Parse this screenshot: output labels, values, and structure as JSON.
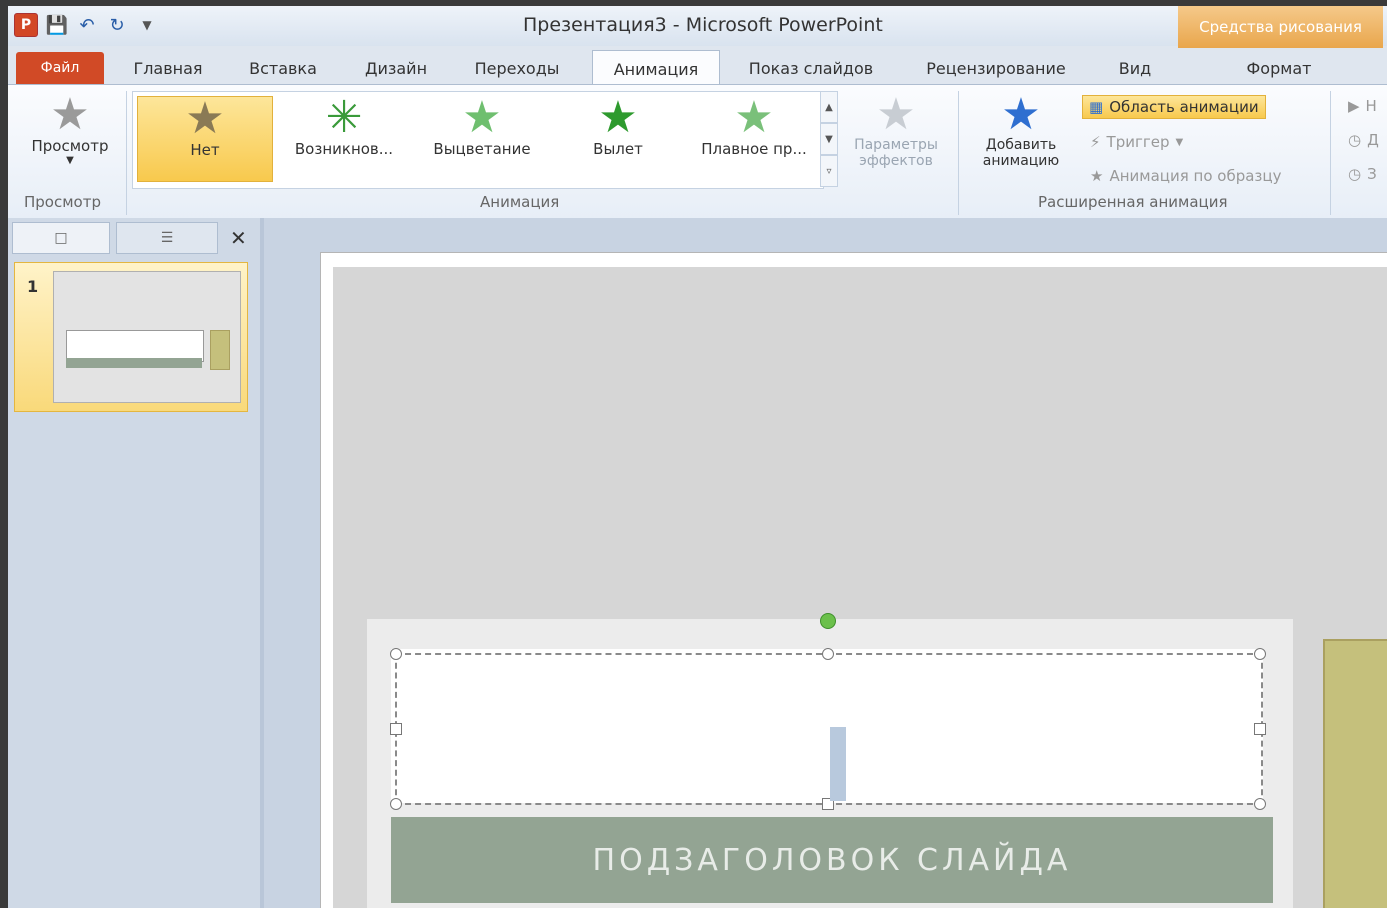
{
  "window": {
    "title": "Презентация3 - Microsoft PowerPoint",
    "context_tab": "Средства рисования"
  },
  "tabs": {
    "file": "Файл",
    "home": "Главная",
    "insert": "Вставка",
    "design": "Дизайн",
    "transitions": "Переходы",
    "animation": "Анимация",
    "slideshow": "Показ слайдов",
    "review": "Рецензирование",
    "view": "Вид",
    "format": "Формат",
    "active": "Анимация"
  },
  "ribbon": {
    "preview": {
      "button": "Просмотр",
      "group": "Просмотр"
    },
    "animation_group": "Анимация",
    "gallery": [
      "Нет",
      "Возникнов...",
      "Выцветание",
      "Вылет",
      "Плавное пр..."
    ],
    "gallery_selected": "Нет",
    "effect_options": "Параметры эффектов",
    "advanced_group": "Расширенная анимация",
    "add_animation": "Добавить анимацию",
    "animation_pane": "Область анимации",
    "trigger": "Триггер",
    "animation_painter": "Анимация по образцу",
    "cut_items": [
      "Н",
      "Д",
      "З"
    ]
  },
  "slides_pane": {
    "slide_number": "1"
  },
  "slide": {
    "subtitle": "ПОДЗАГОЛОВОК СЛАЙДА"
  }
}
